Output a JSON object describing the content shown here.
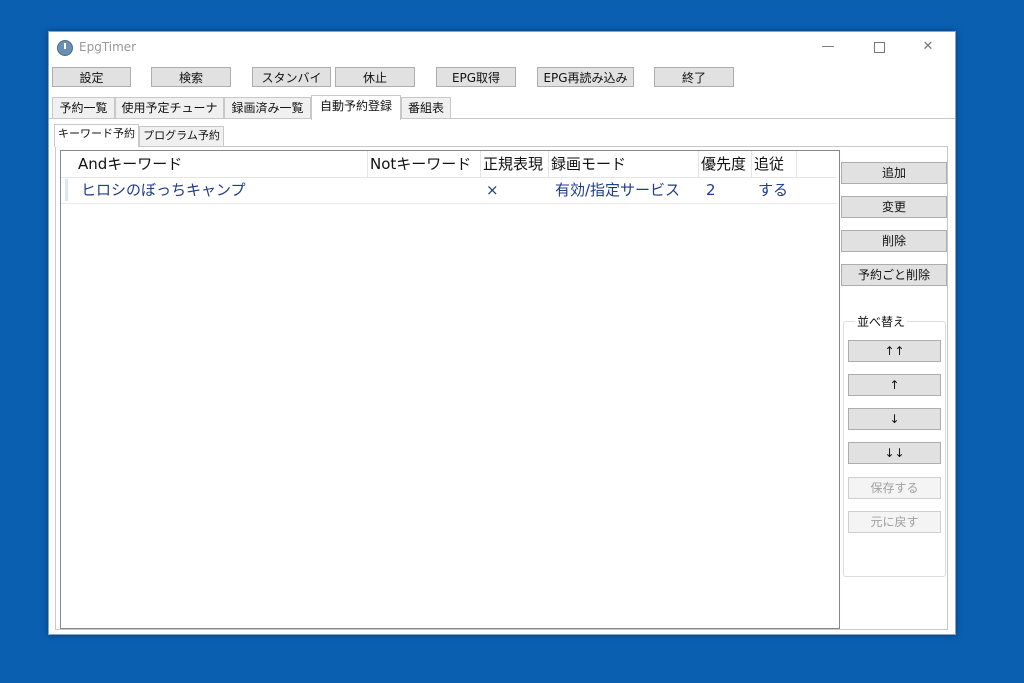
{
  "window": {
    "title": "EpgTimer"
  },
  "toolbar": {
    "buttons": [
      "設定",
      "検索",
      "スタンバイ",
      "休止",
      "EPG取得",
      "EPG再読み込み",
      "終了"
    ]
  },
  "tabs": [
    "予約一覧",
    "使用予定チューナー",
    "録画済み一覧",
    "自動予約登録",
    "番組表"
  ],
  "active_tab": "自動予約登録",
  "subtabs": [
    "キーワード予約",
    "プログラム予約"
  ],
  "active_subtab": "キーワード予約",
  "list": {
    "columns": [
      "Andキーワード",
      "Notキーワード",
      "正規表現",
      "録画モード",
      "優先度",
      "追従"
    ],
    "rows": [
      [
        "ヒロシのぼっちキャンプ",
        "",
        "×",
        "有効/指定サービス",
        "2",
        "する"
      ]
    ]
  },
  "side": {
    "buttons": [
      "追加",
      "変更",
      "削除",
      "予約ごと削除"
    ],
    "sort_group_label": "並べ替え",
    "sort_buttons": [
      "↑↑",
      "↑",
      "↓",
      "↓↓"
    ],
    "save_label": "保存する",
    "revert_label": "元に戻す"
  },
  "colors": {
    "desktop": "#0a5fb0",
    "list_text": "#1e3c8c"
  }
}
